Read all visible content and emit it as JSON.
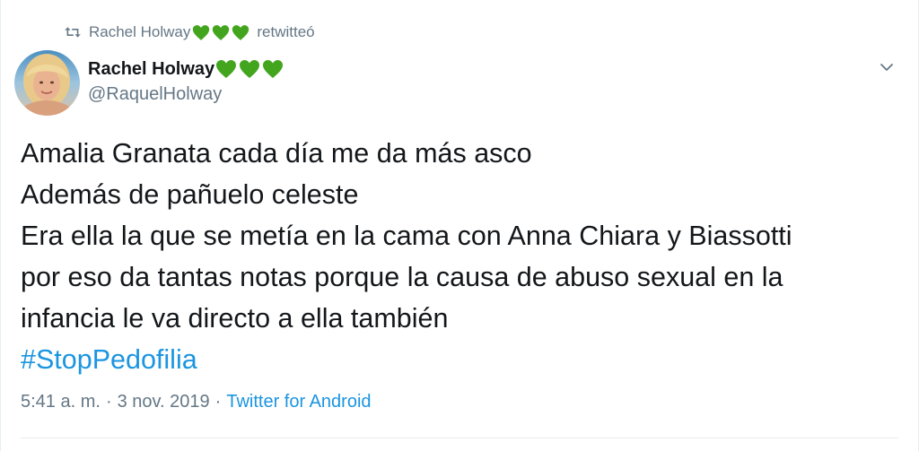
{
  "retweet": {
    "name": "Rachel Holway",
    "suffix": "retwitteó"
  },
  "author": {
    "name": "Rachel Holway",
    "handle": "@RaquelHolway",
    "emoji_icon": "green-heart-icon",
    "emoji_color": "#43a51e"
  },
  "tweet": {
    "lines": [
      "Amalia Granata cada día me da más asco",
      "Además de pañuelo celeste",
      "Era ella la que se metía en la cama con Anna Chiara y Biassotti",
      "por eso da tantas notas porque la causa de abuso sexual en la",
      "infancia le va directo a ella también"
    ],
    "hashtag": "#StopPedofilia"
  },
  "meta": {
    "time": "5:41 a. m.",
    "separator": "·",
    "date": "3 nov. 2019",
    "source": "Twitter for Android"
  },
  "colors": {
    "link": "#1b95e0",
    "secondary": "#657786",
    "text": "#14171a"
  }
}
